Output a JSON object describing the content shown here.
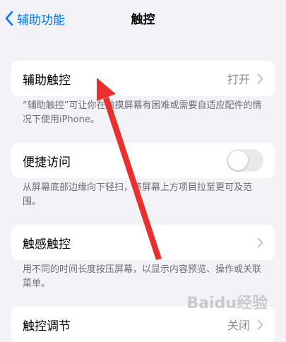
{
  "nav": {
    "back_label": "辅助功能",
    "title": "触控"
  },
  "groups": [
    {
      "label": "辅助触控",
      "value": "打开",
      "footer": "“辅助触控”可让你在触摸屏幕有困难或需要自适应配件的情况下使用iPhone。"
    },
    {
      "label": "便捷访问",
      "toggle_on": false,
      "footer": "从屏幕底部边缘向下轻扫，将屏幕上方项目拉至更可及范围。"
    },
    {
      "label": "触感触控",
      "footer": "用不同的时间长度按压屏幕，以显示内容预览、操作或关联菜单。"
    },
    {
      "label": "触控调节",
      "value": "关闭"
    }
  ],
  "watermark": "Baidu经验",
  "colors": {
    "accent": "#007aff",
    "annotation_arrow": "#e8312f"
  }
}
